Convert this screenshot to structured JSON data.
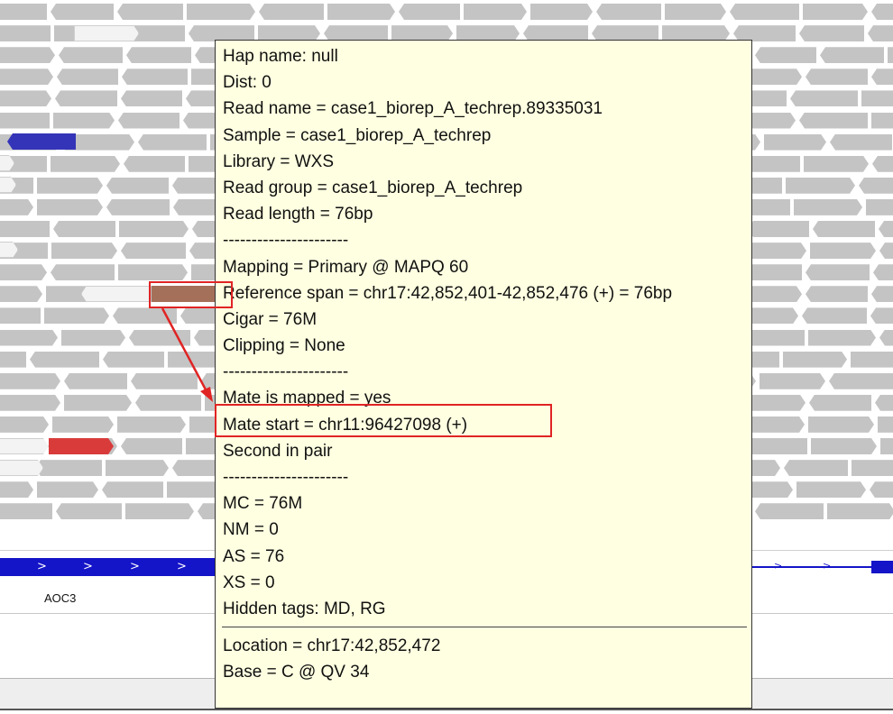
{
  "colors": {
    "read": "#c4c4c4",
    "read_selected": "#a5705a",
    "read_blue": "#3434b8",
    "read_red": "#d93b3b",
    "gene": "#1414c8",
    "tooltip_bg": "#ffffe1",
    "annotation": "#e02424"
  },
  "gene_track": {
    "gene_name": "AOC3",
    "strand_icon": "right-chevron-icon",
    "arrow_glyph": ">"
  },
  "tooltip": {
    "section1": [
      "Hap name: null",
      "Dist: 0",
      "Read name = case1_biorep_A_techrep.89335031",
      "Sample = case1_biorep_A_techrep",
      "Library = WXS",
      "Read group = case1_biorep_A_techrep",
      "Read length = 76bp"
    ],
    "sep1": "----------------------",
    "section2": [
      "Mapping = Primary @ MAPQ 60",
      "Reference span = chr17:42,852,401-42,852,476 (+) = 76bp",
      "Cigar = 76M",
      "Clipping = None"
    ],
    "sep2": "----------------------",
    "section3": [
      "Mate is mapped = yes",
      "Mate start = chr11:96427098 (+)",
      "Second in pair"
    ],
    "sep3": "----------------------",
    "section4": [
      "MC = 76M",
      "NM = 0",
      "AS = 76",
      "XS = 0",
      "Hidden tags: MD, RG"
    ],
    "section5": [
      "Location = chr17:42,852,472",
      "Base = C @ QV 34"
    ]
  }
}
